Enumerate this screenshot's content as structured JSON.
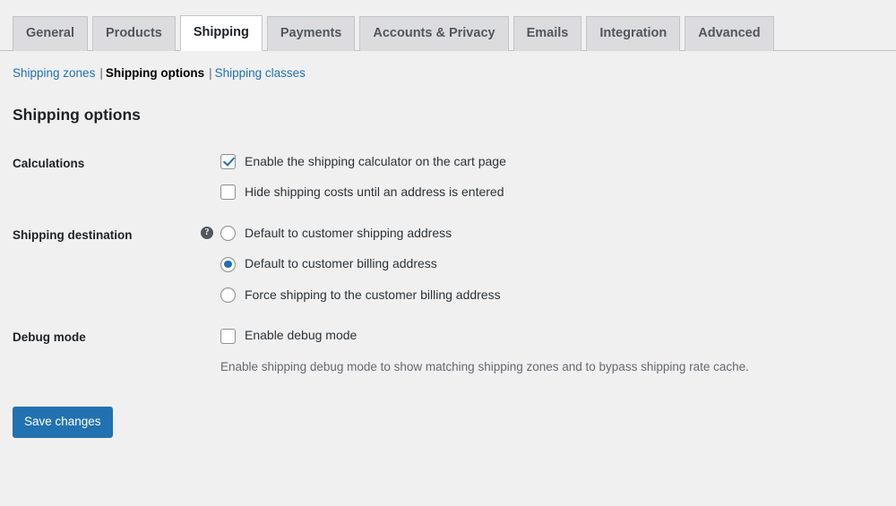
{
  "tabs": [
    {
      "label": "General",
      "active": false
    },
    {
      "label": "Products",
      "active": false
    },
    {
      "label": "Shipping",
      "active": true
    },
    {
      "label": "Payments",
      "active": false
    },
    {
      "label": "Accounts & Privacy",
      "active": false
    },
    {
      "label": "Emails",
      "active": false
    },
    {
      "label": "Integration",
      "active": false
    },
    {
      "label": "Advanced",
      "active": false
    }
  ],
  "subnav": {
    "items": [
      {
        "label": "Shipping zones",
        "current": false
      },
      {
        "label": "Shipping options",
        "current": true
      },
      {
        "label": "Shipping classes",
        "current": false
      }
    ],
    "separator": "|"
  },
  "page": {
    "title": "Shipping options"
  },
  "sections": {
    "calculations": {
      "label": "Calculations",
      "options": [
        {
          "label": "Enable the shipping calculator on the cart page",
          "checked": true
        },
        {
          "label": "Hide shipping costs until an address is entered",
          "checked": false
        }
      ]
    },
    "shipping_destination": {
      "label": "Shipping destination",
      "help_icon": "help-icon",
      "help_glyph": "?",
      "options": [
        {
          "label": "Default to customer shipping address",
          "selected": false
        },
        {
          "label": "Default to customer billing address",
          "selected": true
        },
        {
          "label": "Force shipping to the customer billing address",
          "selected": false
        }
      ]
    },
    "debug_mode": {
      "label": "Debug mode",
      "option": {
        "label": "Enable debug mode",
        "checked": false
      },
      "description": "Enable shipping debug mode to show matching shipping zones and to bypass shipping rate cache."
    }
  },
  "submit": {
    "save_label": "Save changes"
  },
  "colors": {
    "accent": "#2271b1",
    "link": "#2271b1",
    "page_bg": "#f0f0f1",
    "tab_bg": "#dcdcde",
    "border": "#c3c4c7",
    "muted_text": "#646970"
  }
}
